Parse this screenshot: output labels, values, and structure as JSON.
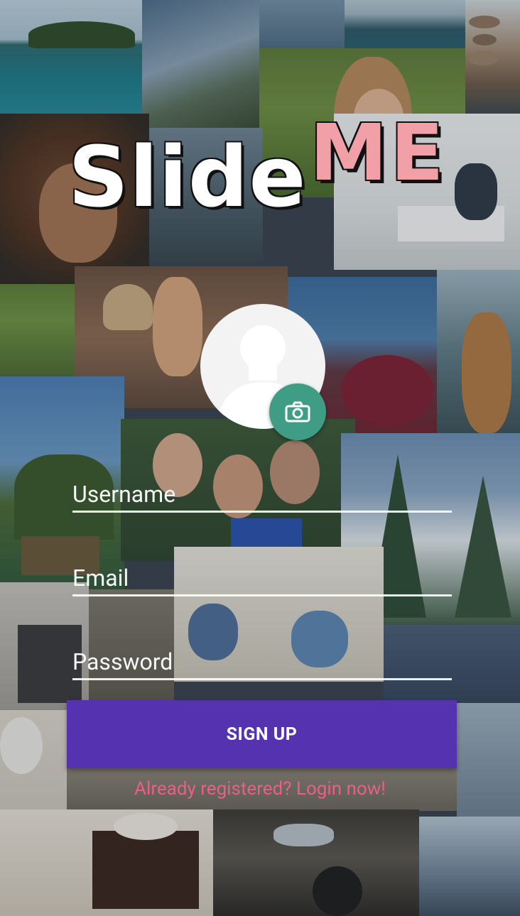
{
  "app": {
    "logo_part1": "Slide",
    "logo_part2": "ME"
  },
  "profile": {
    "avatar_icon": "person-silhouette-icon",
    "camera_icon": "camera-icon"
  },
  "form": {
    "username_placeholder": "Username",
    "email_placeholder": "Email",
    "password_placeholder": "Password",
    "submit_label": "SIGN UP",
    "login_link": "Already registered? Login now!"
  },
  "colors": {
    "primary_button": "#5432b0",
    "camera_button": "#3f9d86",
    "logo_accent": "#f0a0a6",
    "link": "#e85f8a"
  }
}
